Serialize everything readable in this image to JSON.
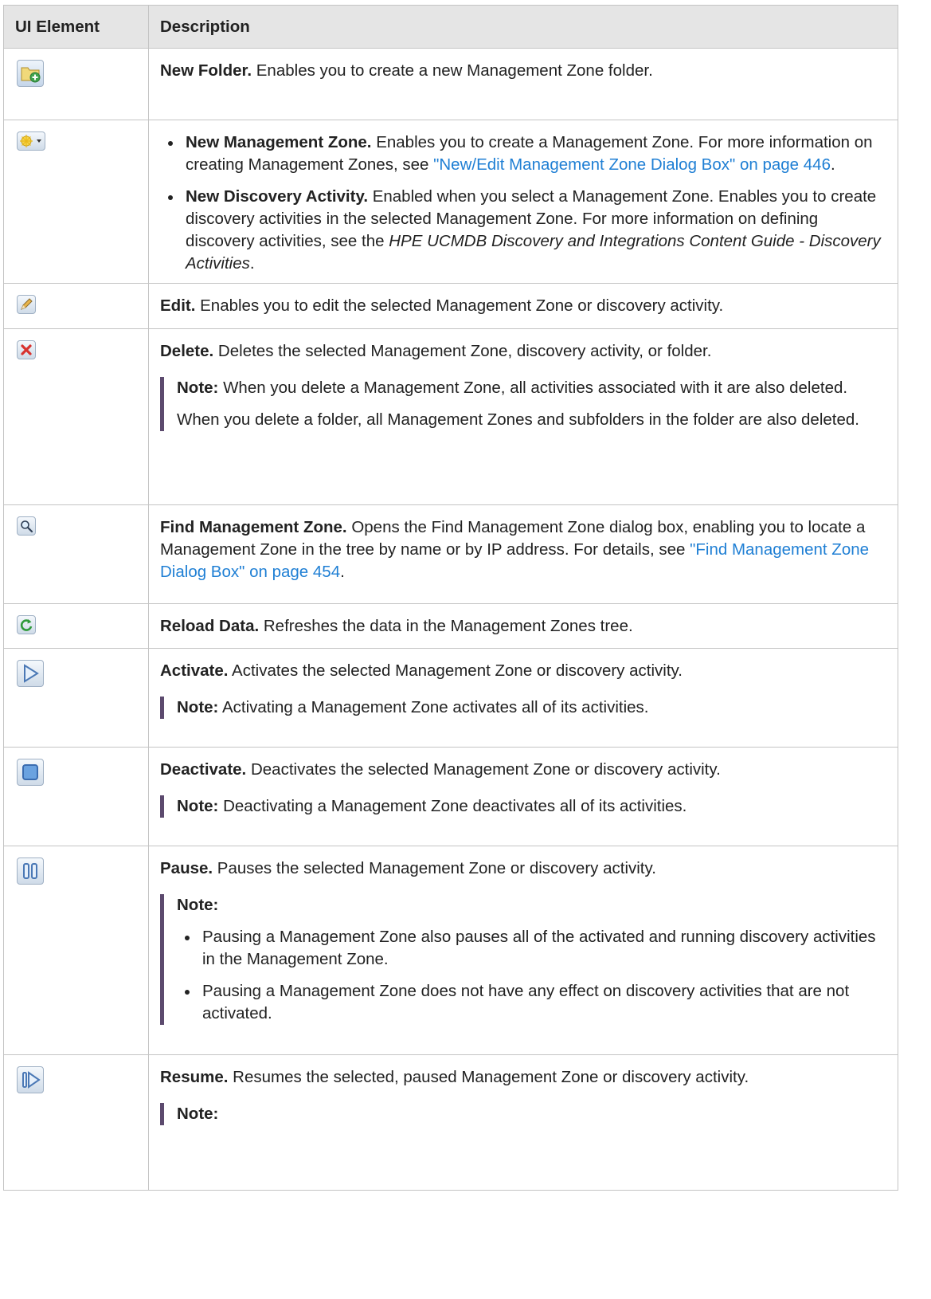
{
  "headers": {
    "ui_element": "UI Element",
    "description": "Description"
  },
  "rows": {
    "new_folder": {
      "icon": "new-folder-icon",
      "title": "New Folder.",
      "text": " Enables you to create a new Management Zone folder."
    },
    "new": {
      "icon": "new-dropdown-icon",
      "item1_title": "New Management Zone.",
      "item1_text": " Enables you to create a Management Zone. For more information on creating Management Zones, see ",
      "item1_link": "\"New/Edit Management Zone Dialog Box\" on page 446",
      "item1_end": ".",
      "item2_title": "New Discovery Activity.",
      "item2_text": " Enabled when you select a Management Zone. Enables you to create discovery activities in the selected Management Zone. For more information on defining discovery activities, see the ",
      "item2_italic": "HPE UCMDB Discovery and Integrations Content Guide - Discovery Activities",
      "item2_end": "."
    },
    "edit": {
      "icon": "edit-pencil-icon",
      "title": "Edit.",
      "text": " Enables you to edit the selected Management Zone or discovery activity."
    },
    "delete": {
      "icon": "delete-x-icon",
      "title": "Delete.",
      "text": " Deletes the selected Management Zone, discovery activity, or folder.",
      "note_label": "Note:",
      "note1": "  When you delete a Management Zone, all activities associated with it are also deleted.",
      "note2": "When you delete a folder, all Management Zones and subfolders in the folder are also deleted."
    },
    "find": {
      "icon": "magnifier-icon",
      "title": "Find Management Zone.",
      "text": " Opens the Find Management Zone dialog box, enabling you to locate a Management Zone in the tree by name or by IP address. For details, see ",
      "link": "\"Find Management Zone Dialog Box\" on page 454",
      "end": "."
    },
    "reload": {
      "icon": "reload-icon",
      "title": "Reload Data.",
      "text": " Refreshes the data in the Management Zones tree."
    },
    "activate": {
      "icon": "play-icon",
      "title": "Activate.",
      "text": " Activates the selected Management Zone or discovery activity.",
      "note_label": "Note:",
      "note": "  Activating a Management Zone activates all of its activities."
    },
    "deactivate": {
      "icon": "stop-icon",
      "title": "Deactivate.",
      "text": " Deactivates the selected Management Zone or discovery activity.",
      "note_label": "Note:",
      "note": "  Deactivating a Management Zone deactivates all of its activities."
    },
    "pause": {
      "icon": "pause-icon",
      "title": "Pause.",
      "text": " Pauses the selected Management Zone or discovery activity.",
      "note_label": "Note:",
      "bullet1": "Pausing a Management Zone also pauses all of the activated and running discovery activities in the Management Zone.",
      "bullet2": "Pausing a Management Zone does not have any effect on discovery activities that are not activated."
    },
    "resume": {
      "icon": "resume-icon",
      "title": "Resume.",
      "text": " Resumes the selected, paused Management Zone or discovery activity.",
      "note_label": "Note:"
    }
  },
  "colors": {
    "link": "#1f7fd4",
    "note_bar": "#5c4a6e",
    "header_bg": "#e5e5e5",
    "border": "#c4c4c4"
  }
}
